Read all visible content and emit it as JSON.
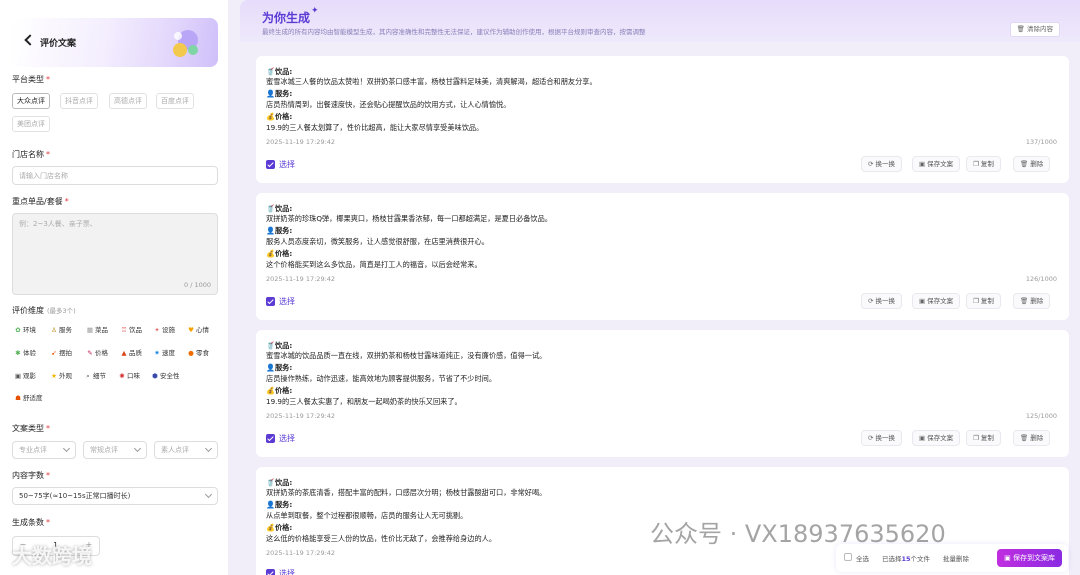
{
  "left": {
    "header_title": "评价文案",
    "platform_label": "平台类型",
    "platforms": [
      "大众点评",
      "抖音点评",
      "高德点评",
      "百度点评",
      "美团点评"
    ],
    "store_label": "门店名称",
    "store_placeholder": "请输入门店名称",
    "item_label": "重点单品/套餐",
    "item_placeholder": "例：2~3人餐、亲子票、",
    "item_count": "0 / 1000",
    "dimension_label": "评价维度",
    "dimension_hint": "(最多3个)",
    "dimensions": [
      {
        "icon": "✿",
        "label": "环境"
      },
      {
        "icon": "♙",
        "label": "服务"
      },
      {
        "icon": "▦",
        "label": "菜品"
      },
      {
        "icon": "♖",
        "label": "饮品"
      },
      {
        "icon": "✦",
        "label": "设施"
      },
      {
        "icon": "♥",
        "label": "心情"
      },
      {
        "icon": "✱",
        "label": "体验"
      },
      {
        "icon": "➹",
        "label": "摆拍"
      },
      {
        "icon": "✎",
        "label": "价格"
      },
      {
        "icon": "▲",
        "label": "品质"
      },
      {
        "icon": "✷",
        "label": "速度"
      },
      {
        "icon": "●",
        "label": "零食"
      },
      {
        "icon": "▣",
        "label": "观影"
      },
      {
        "icon": "★",
        "label": "外观"
      },
      {
        "icon": "⌕",
        "label": "细节"
      },
      {
        "icon": "✺",
        "label": "口味"
      },
      {
        "icon": "⬢",
        "label": "安全性"
      },
      {
        "icon": "☗",
        "label": "舒适度"
      }
    ],
    "copy_type_label": "文案类型",
    "copy_types": [
      "专业点评",
      "常规点评",
      "素人点评"
    ],
    "length_label": "内容字数",
    "length_value": "50~75字(≈10~15s正常口播时长)",
    "count_label": "生成条数",
    "count_value": "1",
    "watermark": "大数跨境"
  },
  "right": {
    "title": "为你生成",
    "subtitle": "最终生成的所有内容均由智能模型生成，其内容准确性和完整性无法保证，建议作为辅助创作使用，根据平台规则审查内容，按需调整",
    "clear_label": "清除内容",
    "select_label": "选择",
    "actions": [
      "换一换",
      "保存文案",
      "复制",
      "删除"
    ],
    "cards": [
      {
        "drink_head": "饮品:",
        "drink": "蜜雪冰城三人餐的饮品太赞啦！双拼奶茶口感丰富，杨枝甘露料足味美，清爽解渴，超适合和朋友分享。",
        "service_head": "服务:",
        "service": "店员热情周到，出餐速度快，还会贴心提醒饮品的饮用方式，让人心情愉悦。",
        "price_head": "价格:",
        "price": "19.9的三人餐太划算了，性价比超高，能让大家尽情享受美味饮品。",
        "time": "2025-11-19 17:29:42",
        "count": "137/1000"
      },
      {
        "drink_head": "饮品:",
        "drink": "双拼奶茶的珍珠Q弹，椰果爽口，杨枝甘露果香浓郁，每一口都超满足，是夏日必备饮品。",
        "service_head": "服务:",
        "service": "服务人员态度亲切，微笑服务，让人感觉很舒服，在店里消费很开心。",
        "price_head": "价格:",
        "price": "这个价格能买到这么多饮品，简直是打工人的福音，以后会经常来。",
        "time": "2025-11-19 17:29:42",
        "count": "126/1000"
      },
      {
        "drink_head": "饮品:",
        "drink": "蜜雪冰城的饮品品质一直在线，双拼奶茶和杨枝甘露味道纯正，没有廉价感，值得一试。",
        "service_head": "服务:",
        "service": "店员操作熟练，动作迅速，能高效地为顾客提供服务，节省了不少时间。",
        "price_head": "价格:",
        "price": "19.9的三人餐太实惠了，和朋友一起喝奶茶的快乐又回来了。",
        "time": "2025-11-19 17:29:42",
        "count": "125/1000"
      },
      {
        "drink_head": "饮品:",
        "drink": "双拼奶茶的茶底清香，搭配丰富的配料，口感层次分明；杨枝甘露酸甜可口，非常好喝。",
        "service_head": "服务:",
        "service": "从点单到取餐，整个过程都很顺畅，店员的服务让人无可挑剔。",
        "price_head": "价格:",
        "price": "这么低的价格能享受三人份的饮品，性价比无敌了，会推荐给身边的人。",
        "time": "2025-11-19 17:29:42",
        "count": ""
      }
    ],
    "footer": {
      "select_all": "全选",
      "selected_prefix": "已选择",
      "selected_count": "15",
      "selected_suffix": "个文件",
      "batch_delete": "批量删除",
      "save_library": "保存到文案库"
    },
    "watermark": "公众号 · VX18937635620"
  }
}
